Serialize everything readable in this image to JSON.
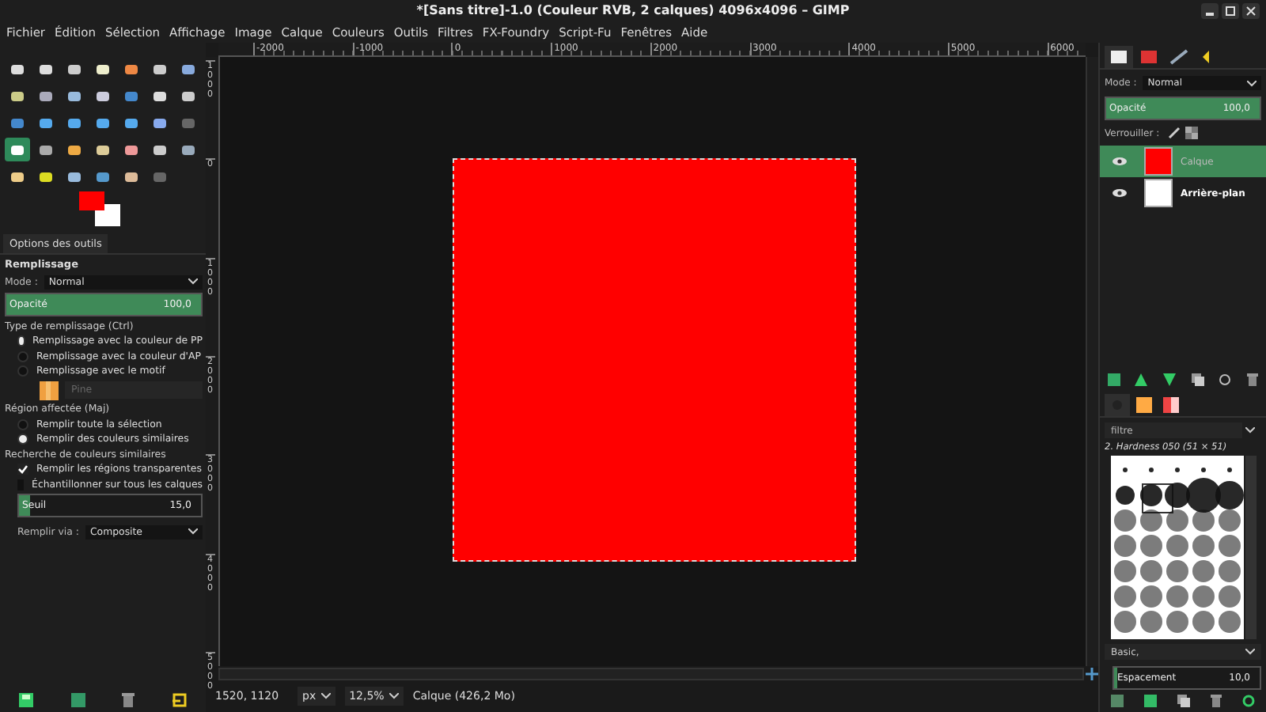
{
  "window": {
    "title": "*[Sans titre]-1.0 (Couleur RVB, 2 calques) 4096x4096 – GIMP"
  },
  "menu": [
    "Fichier",
    "Édition",
    "Sélection",
    "Affichage",
    "Image",
    "Calque",
    "Couleurs",
    "Outils",
    "Filtres",
    "FX-Foundry",
    "Script-Fu",
    "Fenêtres",
    "Aide"
  ],
  "toolbox": {
    "tools": [
      {
        "selected": false
      },
      {
        "selected": false
      },
      {
        "selected": false
      },
      {
        "selected": false
      },
      {
        "selected": false
      },
      {
        "selected": false
      },
      {
        "selected": false
      },
      {
        "selected": false
      },
      {
        "selected": false
      },
      {
        "selected": false
      },
      {
        "selected": false
      },
      {
        "selected": false
      },
      {
        "selected": false
      },
      {
        "selected": false
      },
      {
        "selected": false
      },
      {
        "selected": false
      },
      {
        "selected": false
      },
      {
        "selected": false
      },
      {
        "selected": false
      },
      {
        "selected": false
      },
      {
        "selected": false
      },
      {
        "selected": true
      },
      {
        "selected": false
      },
      {
        "selected": false
      },
      {
        "selected": false
      },
      {
        "selected": false
      },
      {
        "selected": false
      },
      {
        "selected": false
      },
      {
        "selected": false
      },
      {
        "selected": false
      },
      {
        "selected": false
      },
      {
        "selected": false
      },
      {
        "selected": false
      },
      {
        "selected": false
      }
    ]
  },
  "tool_options": {
    "tab": "Options des outils",
    "heading": "Remplissage",
    "mode_label": "Mode :",
    "mode": "Normal",
    "opacity": {
      "label": "Opacité",
      "value": "100,0",
      "level": 1.0
    },
    "fill_type_label": "Type de remplissage (Ctrl)",
    "fill_types": [
      {
        "label": "Remplissage avec la couleur de PP",
        "selected": true
      },
      {
        "label": "Remplissage avec la couleur d'AP",
        "selected": false
      },
      {
        "label": "Remplissage avec le motif",
        "selected": false
      }
    ],
    "pattern": "Pine",
    "region_label": "Région affectée (Maj)",
    "regions": [
      {
        "label": "Remplir toute la sélection",
        "selected": false
      },
      {
        "label": "Remplir des couleurs similaires",
        "selected": true
      }
    ],
    "similar_label": "Recherche de couleurs similaires",
    "options": [
      {
        "label": "Remplir les régions transparentes",
        "checked": true
      },
      {
        "label": "Échantillonner sur tous les calques",
        "checked": false
      }
    ],
    "threshold": {
      "label": "Seuil",
      "value": "15,0",
      "level": 0.06
    },
    "fill_via_label": "Remplir via :",
    "fill_via": "Composite"
  },
  "rulers": {
    "horizontal": [
      "-2000",
      "-1000",
      "0",
      "1000",
      "2000",
      "3000",
      "4000",
      "5000",
      "6000"
    ],
    "vertical": [
      "1000",
      "0",
      "1000",
      "2000",
      "3000",
      "4000",
      "5000"
    ]
  },
  "status_bar": {
    "coords": "1520, 1120",
    "unit": "px",
    "zoom": "12,5%",
    "info": "Calque (426,2 Mo)"
  },
  "layers_panel": {
    "tabs": [
      {
        "selected": true
      },
      {
        "selected": false
      },
      {
        "selected": false
      },
      {
        "selected": false
      }
    ],
    "mode_label": "Mode :",
    "mode": "Normal",
    "opacity": {
      "label": "Opacité",
      "value": "100,0",
      "level": 1.0
    },
    "lock_label": "Verrouiller :",
    "layers": [
      {
        "name": "Calque",
        "color": "#ff0000",
        "visible": true,
        "selected": true
      },
      {
        "name": "Arrière-plan",
        "color": "#ffffff",
        "visible": true,
        "selected": false
      }
    ]
  },
  "brushes_panel": {
    "tabs": [
      {
        "selected": true
      },
      {
        "selected": false
      },
      {
        "selected": false
      }
    ],
    "filter_placeholder": "filtre",
    "brush_name": "2. Hardness 050 (51 × 51)",
    "tag": "Basic,",
    "spacing": {
      "label": "Espacement",
      "value": "10,0",
      "level": 0.02
    }
  }
}
